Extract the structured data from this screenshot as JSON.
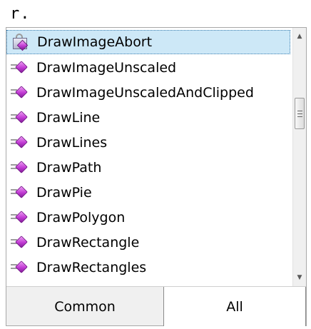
{
  "editor": {
    "code_text": "r."
  },
  "completion": {
    "items": [
      {
        "label": "DrawImageAbort",
        "icon": "delegate-lock-icon",
        "selected": true
      },
      {
        "label": "DrawImageUnscaled",
        "icon": "method-icon"
      },
      {
        "label": "DrawImageUnscaledAndClipped",
        "icon": "method-icon"
      },
      {
        "label": "DrawLine",
        "icon": "method-icon"
      },
      {
        "label": "DrawLines",
        "icon": "method-icon"
      },
      {
        "label": "DrawPath",
        "icon": "method-icon"
      },
      {
        "label": "DrawPie",
        "icon": "method-icon"
      },
      {
        "label": "DrawPolygon",
        "icon": "method-icon"
      },
      {
        "label": "DrawRectangle",
        "icon": "method-icon"
      },
      {
        "label": "DrawRectangles",
        "icon": "method-icon"
      }
    ],
    "tabs": {
      "common": "Common",
      "all": "All"
    },
    "colors": {
      "selection": "#cde8f7",
      "selection_border": "#3c7fb1",
      "method_gem": "#c23bd4"
    }
  }
}
